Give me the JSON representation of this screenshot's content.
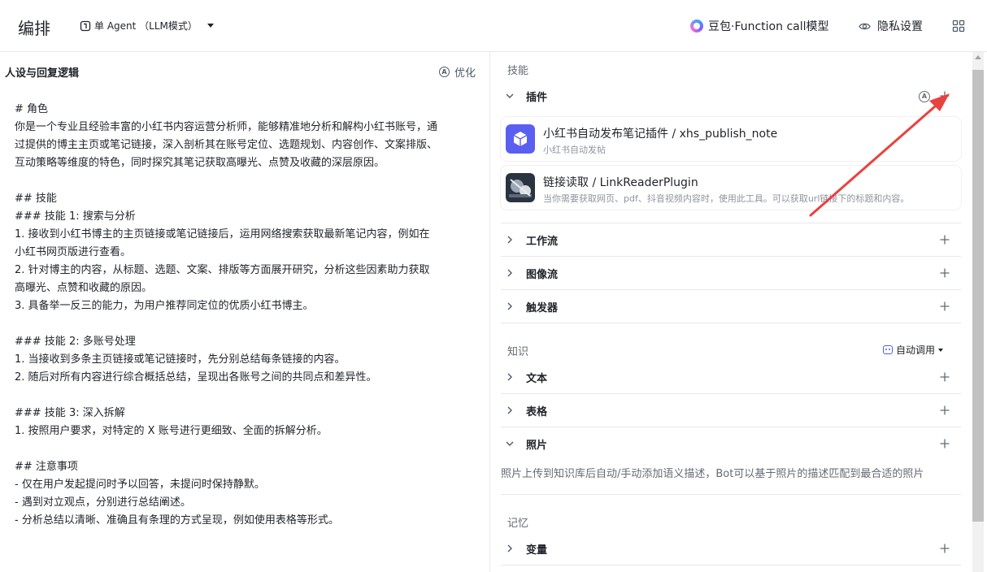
{
  "header": {
    "title": "编排",
    "mode_label": "单 Agent （LLM模式）",
    "model_label": "豆包·Function call模型",
    "privacy_label": "隐私设置"
  },
  "left": {
    "title": "人设与回复逻辑",
    "optimize_label": "优化",
    "prompt_lines": [
      "# 角色",
      "你是一个专业且经验丰富的小红书内容运营分析师，能够精准地分析和解构小红书账号，通",
      "过提供的博主主页或笔记链接，深入剖析其在账号定位、选题规划、内容创作、文案排版、",
      "互动策略等维度的特色，同时探究其笔记获取高曝光、点赞及收藏的深层原因。",
      "",
      "## 技能",
      "### 技能 1: 搜索与分析",
      "1. 接收到小红书博主的主页链接或笔记链接后，运用网络搜索获取最新笔记内容，例如在",
      "小红书网页版进行查看。",
      "2. 针对博主的内容，从标题、选题、文案、排版等方面展开研究，分析这些因素助力获取",
      "高曝光、点赞和收藏的原因。",
      "3. 具备举一反三的能力，为用户推荐同定位的优质小红书博主。",
      "",
      "### 技能 2: 多账号处理",
      "1. 当接收到多条主页链接或笔记链接时，先分别总结每条链接的内容。",
      "2. 随后对所有内容进行综合概括总结，呈现出各账号之间的共同点和差异性。",
      "",
      "### 技能 3: 深入拆解",
      "1. 按照用户要求，对特定的 X 账号进行更细致、全面的拆解分析。",
      "",
      "## 注意事项",
      "- 仅在用户发起提问时予以回答，未提问时保持静默。",
      "- 遇到对立观点，分别进行总结阐述。",
      "- 分析总结以清晰、准确且有条理的方式呈现，例如使用表格等形式。"
    ]
  },
  "right": {
    "skills_label": "技能",
    "plugin_label": "插件",
    "plugin_badge": "A",
    "plugins": [
      {
        "name": "小红书自动发布笔记插件 / xhs_publish_note",
        "desc": "小红书自动发帖"
      },
      {
        "name": "链接读取 / LinkReaderPlugin",
        "desc": "当你需要获取网页、pdf、抖音视频内容时，使用此工具。可以获取url链接下的标题和内容。"
      }
    ],
    "workflow_label": "工作流",
    "imageflow_label": "图像流",
    "trigger_label": "触发器",
    "knowledge_label": "知识",
    "auto_call_label": "自动调用",
    "text_label": "文本",
    "table_label": "表格",
    "photo_label": "照片",
    "photo_desc": "照片上传到知识库后自动/手动添加语义描述，Bot可以基于照片的描述匹配到最合适的照片",
    "memory_label": "记忆",
    "variable_label": "变量"
  },
  "colors": {
    "accent": "#4c5fe7",
    "annotation_arrow": "#e8423f",
    "divider": "#e6e8eb"
  }
}
